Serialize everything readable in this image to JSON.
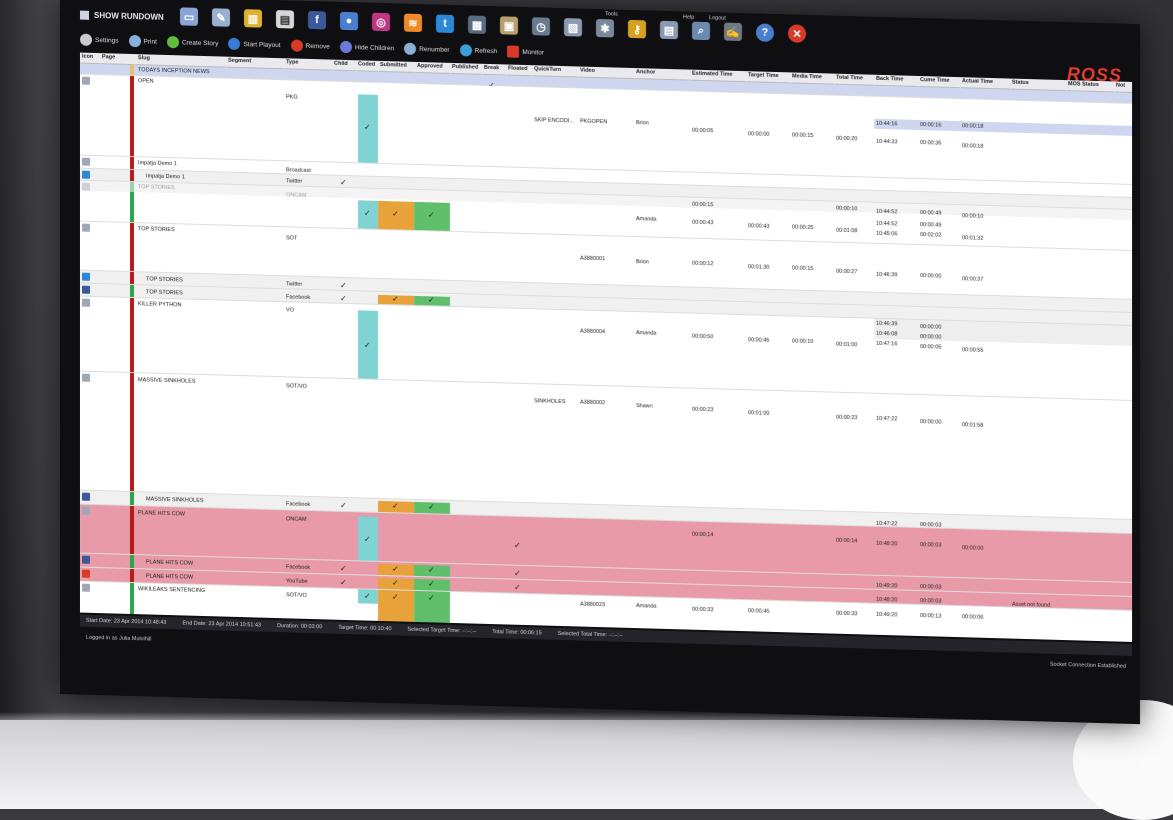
{
  "window": {
    "title": "SHOW RUNDOWN",
    "brand": "ROSS"
  },
  "topbar": {
    "tools_label": "Tools",
    "help_label": "Help",
    "logout_label": "Logout"
  },
  "actions": [
    "Settings",
    "Print",
    "Create Story",
    "Start Playout",
    "Remove",
    "Hide Children",
    "Renumber",
    "Refresh",
    "Monitor"
  ],
  "columns": [
    "Icon",
    "Page",
    "Slug",
    "Segment",
    "Type",
    "Child",
    "Coded",
    "Submitted",
    "Approved",
    "Published",
    "Break",
    "Floated",
    "QuickTurn",
    "Video",
    "Anchor",
    "Estimated Time",
    "Target Time",
    "Media Time",
    "Total Time",
    "Back Time",
    "Cume Time",
    "Actual Time",
    "Status",
    "MOS Status",
    "Not"
  ],
  "rows": [
    {
      "slug": "TODAYS INCEPTION NEWS",
      "type": "",
      "stripe": "#e8c26a",
      "bg": "#cfd6ef"
    },
    {
      "slug": "OPEN",
      "type": "PKG",
      "video": "PKGOPEN",
      "anchor": "Brion",
      "quick": "SKIP ENCODI...",
      "est": "00:00:05",
      "target": "00:00:00",
      "media": "00:00:15",
      "total": "00:00:20",
      "back": "10:44:16",
      "back2": "10:44:33",
      "cume": "00:00:16",
      "cume2": "00:00:36",
      "actual": "00:00:18",
      "actual2": "00:00:18",
      "stripe": "#b41a1a"
    },
    {
      "slug": "Impatja Demo 1",
      "type": "Broadcast"
    },
    {
      "slug": "Impatja Demo 1",
      "type": "Twitter"
    },
    {
      "slug": "TOP STORIES",
      "type": "ONCAM",
      "est": "00:00:15",
      "total": "00:00:10",
      "back": "10:44:52",
      "cume": "00:00:49",
      "actual": "00:00:10",
      "anchor": "Amanda",
      "est2": "00:00:43",
      "target": "00:00:43",
      "media": "00:00:25",
      "total2": "00:01:08",
      "back2": "10:45:06",
      "cume2": "00:02:02",
      "actual2": "00:01:32",
      "back3": "10:44:52",
      "cume3": "00:00:49"
    },
    {
      "slug": "TOP STORIES",
      "type": "SOT",
      "video": "A3880001",
      "anchor": "Brion",
      "est": "00:00:12",
      "target": "00:01:30",
      "media": "00:00:15",
      "total": "00:00:27",
      "back": "10:46:39",
      "cume": "00:00:00",
      "actual": "00:00:37"
    },
    {
      "slug": "TOP STORIES",
      "type": "Twitter"
    },
    {
      "slug": "TOP STORIES",
      "type": "Facebook"
    },
    {
      "slug": "KILLER PYTHON",
      "type": "VO",
      "video": "A3880004",
      "anchor": "Amanda",
      "est": "00:00:50",
      "target": "00:00:45",
      "media": "00:00:10",
      "total": "00:01:00",
      "back": "10:46:39",
      "back2": "10:46:08",
      "back3": "10:47:16",
      "cume": "00:00:00",
      "cume2": "00:00:00",
      "cume3": "00:00:05",
      "actual": "00:00:55"
    },
    {
      "slug": "MASSIVE SINKHOLES",
      "type": "SOT/VO",
      "quick": "SINKHOLES",
      "video": "A3880002",
      "anchor": "Shawn",
      "est": "00:00:23",
      "target": "00:01:00",
      "total": "00:00:23",
      "back": "10:47:22",
      "cume": "00:00:00",
      "actual": "00:01:58"
    },
    {
      "slug": "MASSIVE SINKHOLES",
      "type": "Facebook"
    },
    {
      "slug": "PLANE HITS COW",
      "type": "ONCAM",
      "est": "00:00:14",
      "total": "00:00:14",
      "back": "10:48:20",
      "back0": "10:47:22",
      "cume": "00:00:03",
      "cume0": "00:00:03",
      "actual": "00:00:00"
    },
    {
      "slug": "PLANE HITS COW",
      "type": "Facebook"
    },
    {
      "slug": "PLANE HITS COW",
      "type": "YouTube",
      "back": "10:49:20",
      "cume": "00:00:03",
      "back2": "10:48:20",
      "cume2": "00:00:03",
      "status": "Asset not found"
    },
    {
      "slug": "WIKILEAKS SENTENCING",
      "type": "SOT/VO",
      "video": "A3880023",
      "anchor": "Amanda",
      "est": "00:00:33",
      "target": "00:00:45",
      "total": "00:00:33",
      "back": "10:49:20",
      "cume": "00:00:13",
      "actual": "00:00:06"
    }
  ],
  "status_bar": {
    "start": "Start Date: 23 Apr 2014 10:48:43",
    "end": "End Date: 23 Apr 2014 10:51:43",
    "duration": "Duration: 00:03:00",
    "target": "Target Time: 00:10:40",
    "sel_target": "Selected Target Time: --:--:--",
    "total": "Total Time: 00:06:15",
    "sel_total": "Selected Total Time: --:--:--"
  },
  "footer": {
    "user": "Logged in as Julia Mulvihill",
    "connection": "Socket Connection Established"
  },
  "colors": {
    "cyan": "#7fd3d3",
    "orange": "#e8a23a",
    "green": "#5fbf6a",
    "red_stripe": "#b41a1a",
    "green_stripe": "#2aa64a",
    "pink": "#e89aa8"
  }
}
